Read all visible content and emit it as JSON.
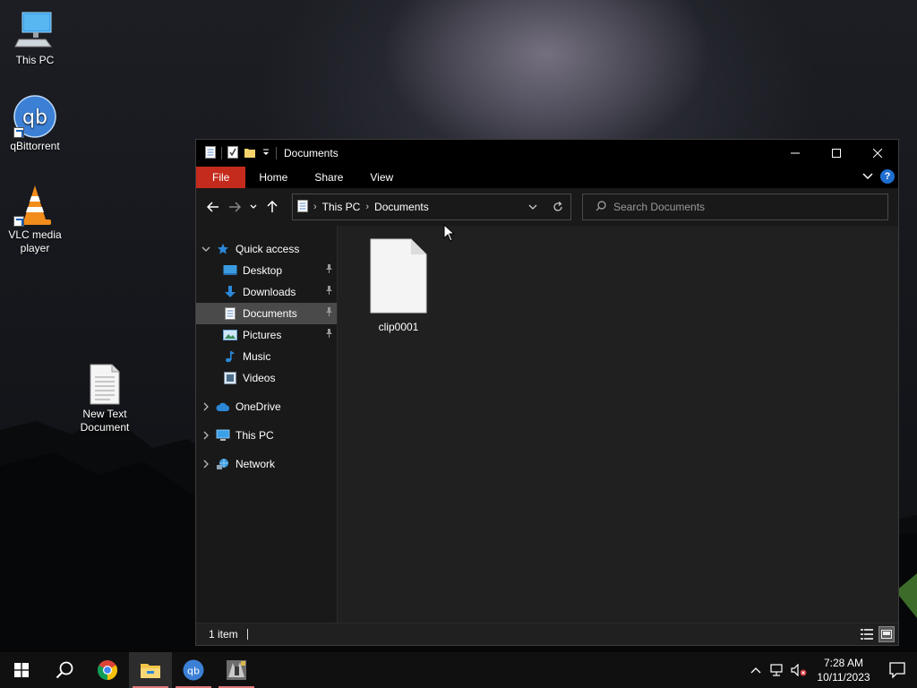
{
  "desktop": {
    "icons": [
      {
        "label": "This PC"
      },
      {
        "label": "qBittorrent"
      },
      {
        "label": "VLC media player"
      },
      {
        "label": "New Text Document"
      }
    ]
  },
  "window": {
    "title": "Documents",
    "controls": {
      "minimize": "minimize",
      "maximize": "maximize",
      "close": "close"
    },
    "ribbon": {
      "tabs": [
        "File",
        "Home",
        "Share",
        "View"
      ],
      "help": "?"
    },
    "address": {
      "crumbs": [
        "This PC",
        "Documents"
      ]
    },
    "search": {
      "placeholder": "Search Documents"
    },
    "nav_pane": {
      "quick_access": "Quick access",
      "quick_items": [
        {
          "label": "Desktop",
          "pinned": true
        },
        {
          "label": "Downloads",
          "pinned": true
        },
        {
          "label": "Documents",
          "pinned": true,
          "selected": true
        },
        {
          "label": "Pictures",
          "pinned": true
        },
        {
          "label": "Music",
          "pinned": false
        },
        {
          "label": "Videos",
          "pinned": false
        }
      ],
      "onedrive": "OneDrive",
      "this_pc": "This PC",
      "network": "Network"
    },
    "files": [
      {
        "name": "clip0001",
        "icon": "blank-file-icon"
      }
    ],
    "status": {
      "count": "1 item"
    }
  },
  "taskbar": {
    "pinned": [
      "start-icon",
      "search-icon",
      "chrome-icon",
      "file-explorer-icon",
      "qbittorrent-icon",
      "app-icon"
    ],
    "clock": {
      "time": "7:28 AM",
      "date": "10/11/2023"
    }
  },
  "colors": {
    "file_tab": "#c42b1c",
    "selected_nav": "#4a4a4a",
    "running_indicator": "#e0787a"
  }
}
